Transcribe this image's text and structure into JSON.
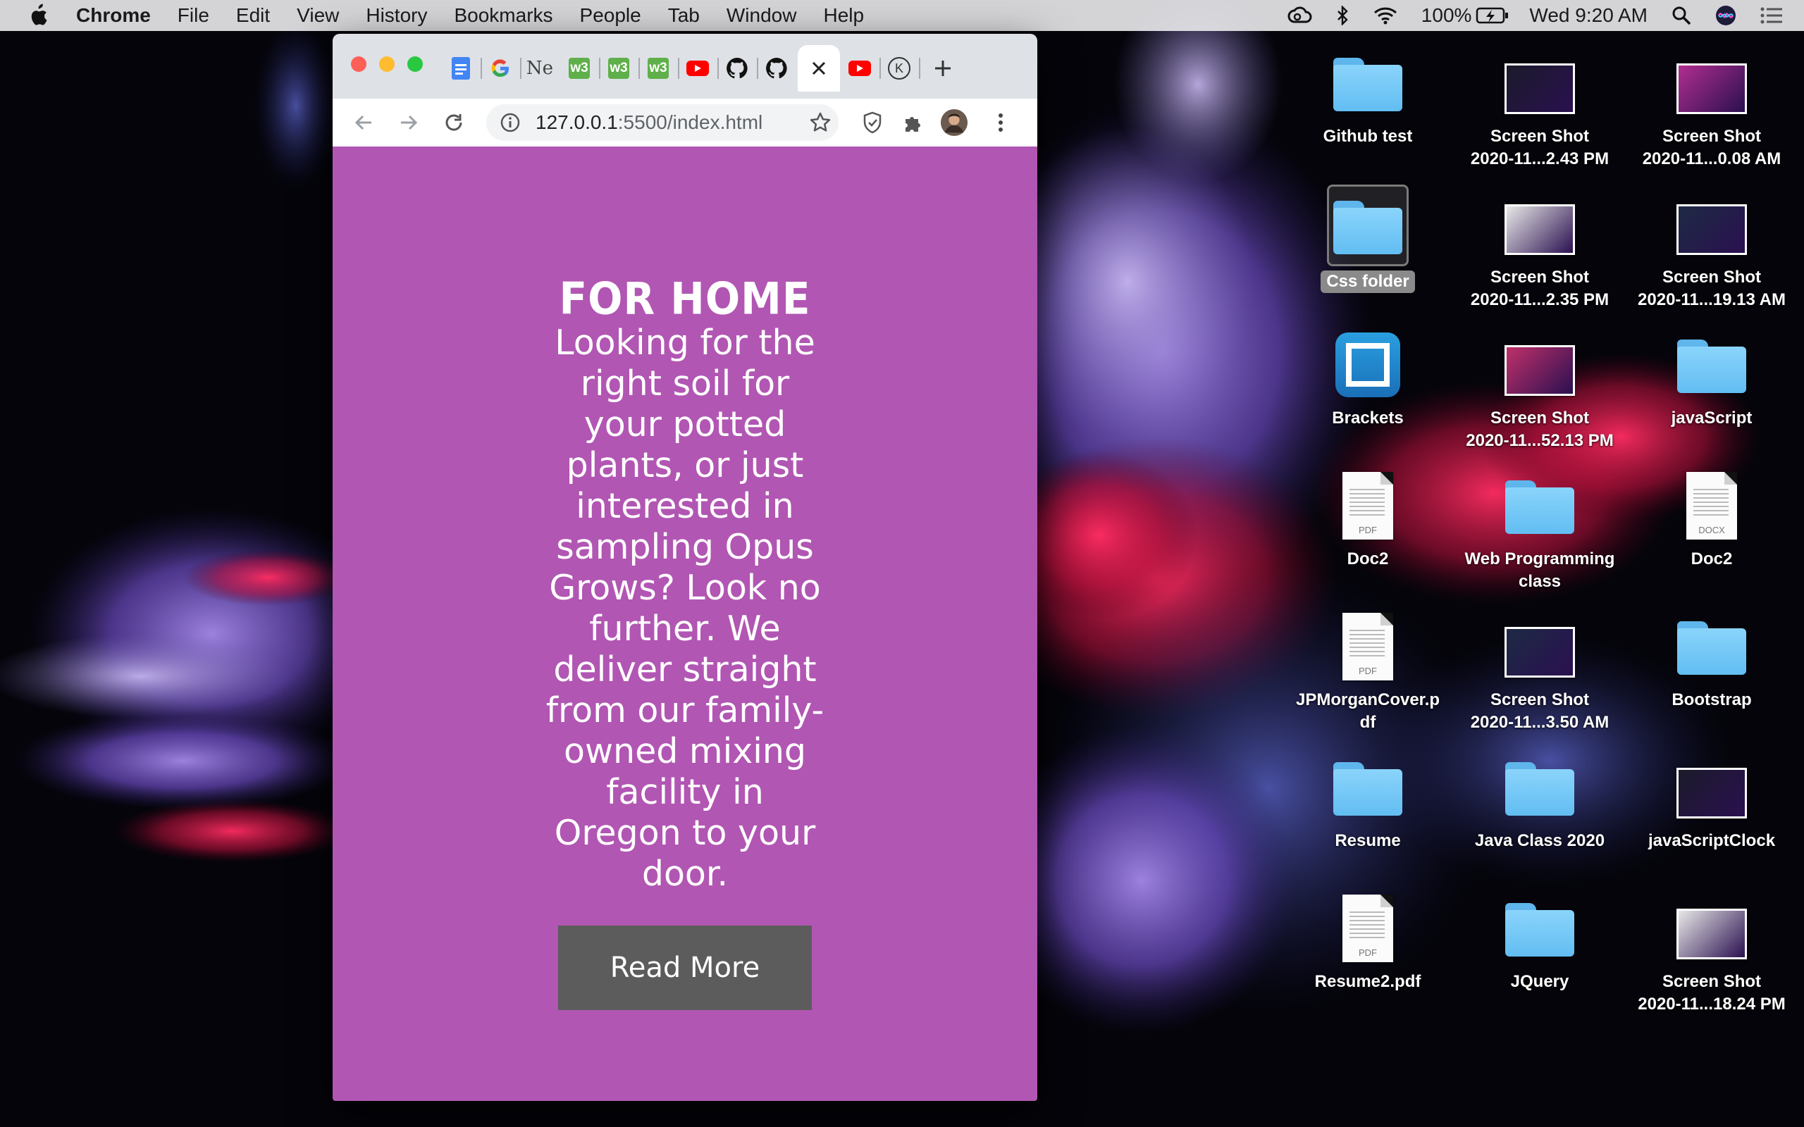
{
  "menubar": {
    "app": "Chrome",
    "menus": [
      "File",
      "Edit",
      "View",
      "History",
      "Bookmarks",
      "People",
      "Tab",
      "Window",
      "Help"
    ],
    "battery": "100%",
    "clock": "Wed 9:20 AM",
    "icons": [
      "creative-cloud-icon",
      "bluetooth-icon",
      "wifi-icon",
      "battery-icon",
      "spotlight-icon",
      "siri-icon",
      "notification-center-icon"
    ]
  },
  "browser": {
    "tabs": [
      {
        "icon": "google-docs-icon"
      },
      {
        "icon": "google-icon"
      },
      {
        "icon": "ne-icon",
        "text": "Ne"
      },
      {
        "icon": "w3schools-icon",
        "text": "w3"
      },
      {
        "icon": "w3schools-icon",
        "text": "w3"
      },
      {
        "icon": "w3schools-icon",
        "text": "w3"
      },
      {
        "icon": "youtube-icon"
      },
      {
        "icon": "github-icon"
      },
      {
        "icon": "github-icon"
      },
      {
        "icon": "close-icon",
        "active": true
      },
      {
        "icon": "youtube-icon"
      },
      {
        "icon": "k-icon",
        "text": "K"
      }
    ],
    "url_host": "127.0.0.1",
    "url_rest": ":5500/index.html"
  },
  "page": {
    "heading": "FOR HOME",
    "body": "Looking for the right soil for your potted plants, or just interested in sampling Opus Grows? Look no further. We deliver straight from our family-owned mixing facility in Oregon to your door.",
    "button": "Read More",
    "background": "#b156b3",
    "button_color": "#5c5c5c"
  },
  "desktop": {
    "icons": [
      {
        "label": "Github test",
        "kind": "folder"
      },
      {
        "label": "Screen Shot\n2020-11...2.43 PM",
        "kind": "screenshot"
      },
      {
        "label": "Screen Shot\n2020-11...0.08 AM",
        "kind": "screenshot"
      },
      {
        "label": "Css folder",
        "kind": "folder",
        "selected": true
      },
      {
        "label": "Screen Shot\n2020-11...2.35 PM",
        "kind": "screenshot"
      },
      {
        "label": "Screen Shot\n2020-11...19.13 AM",
        "kind": "screenshot"
      },
      {
        "label": "Brackets",
        "kind": "app"
      },
      {
        "label": "Screen Shot\n2020-11...52.13 PM",
        "kind": "screenshot"
      },
      {
        "label": "javaScript",
        "kind": "folder"
      },
      {
        "label": "Doc2",
        "kind": "pdf",
        "ftype": "PDF"
      },
      {
        "label": "Web Programming\nclass",
        "kind": "folder"
      },
      {
        "label": "Doc2",
        "kind": "docx",
        "ftype": "DOCX"
      },
      {
        "label": "JPMorganCover.p\ndf",
        "kind": "pdf",
        "ftype": "PDF"
      },
      {
        "label": "Screen Shot\n2020-11...3.50 AM",
        "kind": "screenshot"
      },
      {
        "label": "Bootstrap",
        "kind": "folder"
      },
      {
        "label": "Resume",
        "kind": "folder"
      },
      {
        "label": "Java Class 2020",
        "kind": "folder"
      },
      {
        "label": "javaScriptClock",
        "kind": "screenshot"
      },
      {
        "label": "Resume2.pdf",
        "kind": "pdf",
        "ftype": "PDF"
      },
      {
        "label": "JQuery",
        "kind": "folder"
      },
      {
        "label": "Screen Shot\n2020-11...18.24 PM",
        "kind": "screenshot"
      }
    ]
  }
}
